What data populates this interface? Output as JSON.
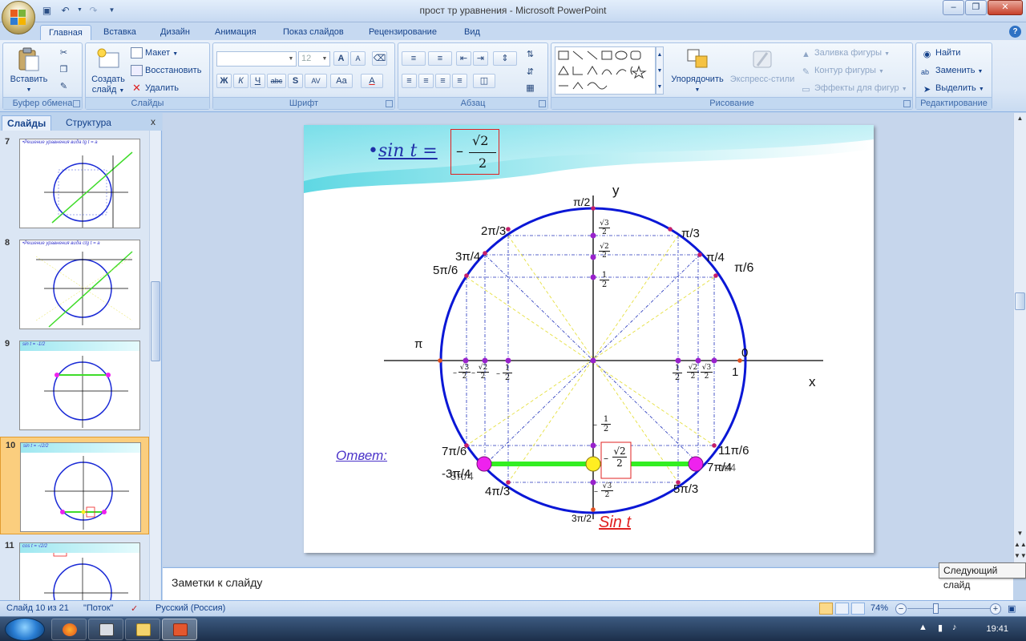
{
  "window": {
    "title": "прост тр уравнения - Microsoft PowerPoint"
  },
  "ribbon_tabs": [
    "Главная",
    "Вставка",
    "Дизайн",
    "Анимация",
    "Показ слайдов",
    "Рецензирование",
    "Вид"
  ],
  "groups": {
    "clipboard": {
      "label": "Буфер обмена",
      "paste": "Вставить"
    },
    "slides": {
      "label": "Слайды",
      "create_line1": "Создать",
      "create_line2": "слайд",
      "layout": "Макет",
      "reset": "Восстановить",
      "delete": "Удалить"
    },
    "font": {
      "label": "Шрифт",
      "font_name": "",
      "font_size": "12",
      "bold": "Ж",
      "italic": "К",
      "underline": "Ч",
      "strike": "abc",
      "shadow": "S",
      "spacing": "AV",
      "case": "Aa",
      "grow": "A",
      "shrink": "A",
      "color": "A"
    },
    "paragraph": {
      "label": "Абзац"
    },
    "drawing": {
      "label": "Рисование",
      "arrange": "Упорядочить",
      "quick_styles": "Экспресс-стили",
      "fill": "Заливка фигуры",
      "outline": "Контур фигуры",
      "effects": "Эффекты для фигур"
    },
    "editing": {
      "label": "Редактирование",
      "find": "Найти",
      "replace": "Заменить",
      "select": "Выделить"
    }
  },
  "left_pane": {
    "tab_slides": "Слайды",
    "tab_outline": "Структура",
    "thumbnails": [
      {
        "number": "7",
        "title": "•Решение уравнения вида  tg t = a"
      },
      {
        "number": "8",
        "title": "•Решение уравнения вида  ctg t = a"
      },
      {
        "number": "9",
        "title": "sin t = -1/2"
      },
      {
        "number": "10",
        "title": "sin t = -√2/2"
      },
      {
        "number": "11",
        "title": "cos t = √2/2"
      }
    ]
  },
  "slide": {
    "title_bullet": "•",
    "title": "sin t =",
    "title_fraction": {
      "sign": "–",
      "numerator": "√2",
      "denominator": "2"
    },
    "axis_y": "y",
    "axis_x": "x",
    "answer": "Ответ:",
    "sin_caption": "Sin t",
    "angles": {
      "pi2": "π/2",
      "pi3": "π/3",
      "pi4": "π/4",
      "pi6": "π/6",
      "2pi3": "2π/3",
      "3pi4": "3π/4",
      "5pi6": "5π/6",
      "pi": "π",
      "zero": "0",
      "one": "1",
      "7pi6": "7π/6",
      "11pi6": "11π/6",
      "4pi3": "4π/3",
      "5pi3": "5π/3",
      "3pi2": "3π/2",
      "minus3pi4": "-3π/4",
      "minus5pi4": "-5π/4",
      "7pi4": "7π/4",
      "minus_pi4": "-π/4"
    },
    "fractions": {
      "half": {
        "num": "1",
        "den": "2"
      },
      "sqrt2_2": {
        "num": "√2",
        "den": "2"
      },
      "sqrt3_2": {
        "num": "√3",
        "den": "2"
      },
      "neg_half": {
        "sign": "–",
        "num": "1",
        "den": "2"
      },
      "neg_sqrt2_2": {
        "sign": "–",
        "num": "√2",
        "den": "2"
      },
      "neg_sqrt3_2": {
        "sign": "–",
        "num": "√3",
        "den": "2"
      }
    }
  },
  "notes": {
    "placeholder": "Заметки к слайду"
  },
  "tooltip": "Следующий слайд",
  "status": {
    "slide_info": "Слайд 10 из 21",
    "theme": "\"Поток\"",
    "language": "Русский (Россия)",
    "zoom": "74%"
  },
  "taskbar": {
    "clock": "19:41"
  },
  "colors": {
    "circle": "#0a17d6",
    "green_segment": "#33ee22",
    "magenta_point": "#ee22ee",
    "yellow_point": "#ffee22",
    "red_box": "#e02020",
    "answer_text": "#4b33c9"
  }
}
